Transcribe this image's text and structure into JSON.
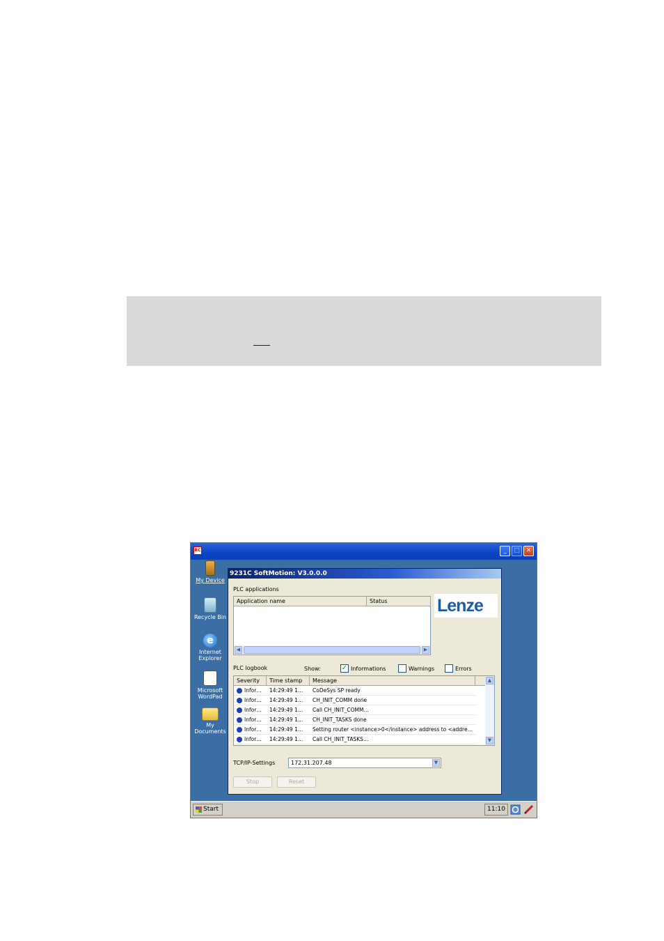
{
  "screen": {
    "desktop_icons": [
      {
        "label_line1": "My Device",
        "label_line2": "",
        "icon": "handheld-device-icon"
      },
      {
        "label_line1": "Recycle Bin",
        "label_line2": "",
        "icon": "recycle-bin-icon"
      },
      {
        "label_line1": "Internet",
        "label_line2": "Explorer",
        "icon": "internet-explorer-icon"
      },
      {
        "label_line1": "Microsoft",
        "label_line2": "WordPad",
        "icon": "wordpad-icon"
      },
      {
        "label_line1": "My",
        "label_line2": "Documents",
        "icon": "folder-icon"
      }
    ],
    "app": {
      "title": "9231C SoftMotion: V3.0.0.0",
      "plc_applications_label": "PLC applications",
      "apps_columns": [
        "Application name",
        "Status"
      ],
      "logo_text": "Lenze",
      "logbook_label": "PLC logbook",
      "show_label": "Show:",
      "filters": [
        {
          "label": "Informations",
          "checked": true
        },
        {
          "label": "Warnings",
          "checked": false
        },
        {
          "label": "Errors",
          "checked": false
        }
      ],
      "log_columns": [
        "Severity",
        "Time stamp",
        "Message"
      ],
      "log_rows": [
        {
          "severity": "Infor…",
          "time": "14:29:49 1…",
          "message": "CoDeSys SP ready"
        },
        {
          "severity": "Infor…",
          "time": "14:29:49 1…",
          "message": "CH_INIT_COMM done"
        },
        {
          "severity": "Infor…",
          "time": "14:29:49 1…",
          "message": "Call CH_INIT_COMM…"
        },
        {
          "severity": "Infor…",
          "time": "14:29:49 1…",
          "message": "CH_INIT_TASKS done"
        },
        {
          "severity": "Infor…",
          "time": "14:29:49 1…",
          "message": "Setting router <instance>0</instance> address to <addre…"
        },
        {
          "severity": "Infor…",
          "time": "14:29:49 1…",
          "message": "Call CH_INIT_TASKS…"
        }
      ],
      "tcpip_label": "TCP/IP-Settings",
      "tcpip_value": "172.31.207.48",
      "stop_label": "Stop",
      "reset_label": "Reset"
    },
    "taskbar": {
      "start_label": "Start",
      "clock": "11:10"
    }
  }
}
